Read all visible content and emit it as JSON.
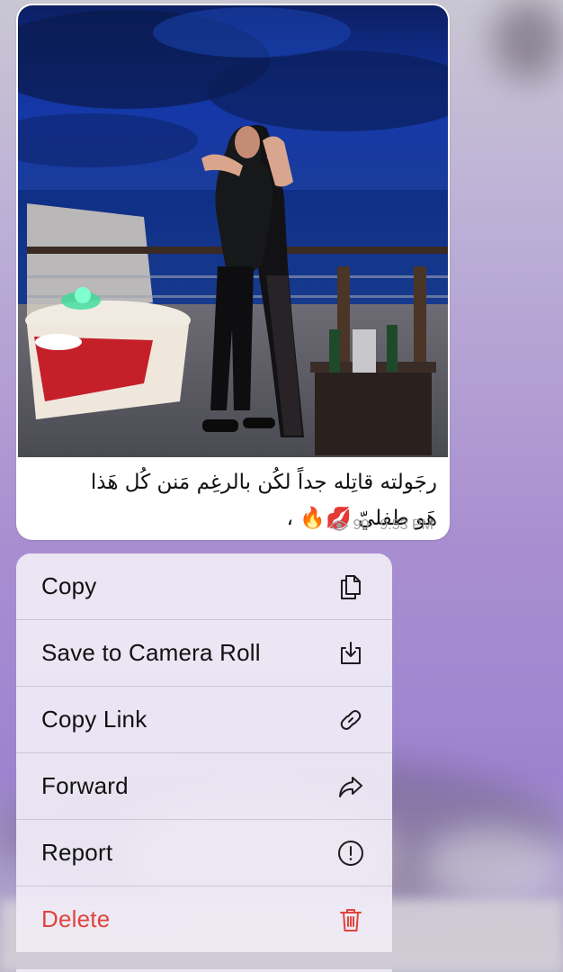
{
  "message": {
    "caption_line1": "رجَولته قاتِله جداً لكُن بالرغِم مَنن كُل هَذا",
    "caption_line2": "هَو طفليّ 💋🔥 ،",
    "views": "90",
    "time": "9:53 PM"
  },
  "context_menu": {
    "items": [
      {
        "label": "Copy",
        "icon": "copy-icon"
      },
      {
        "label": "Save to Camera Roll",
        "icon": "save-download-icon"
      },
      {
        "label": "Copy Link",
        "icon": "link-icon"
      },
      {
        "label": "Forward",
        "icon": "forward-arrow-icon"
      },
      {
        "label": "Report",
        "icon": "exclamation-circle-icon"
      },
      {
        "label": "Delete",
        "icon": "trash-icon"
      }
    ]
  },
  "colors": {
    "destructive": "#e0443c",
    "menu_text": "#111111",
    "meta_text": "#9a9a9f",
    "bubble": "#ffffff"
  }
}
